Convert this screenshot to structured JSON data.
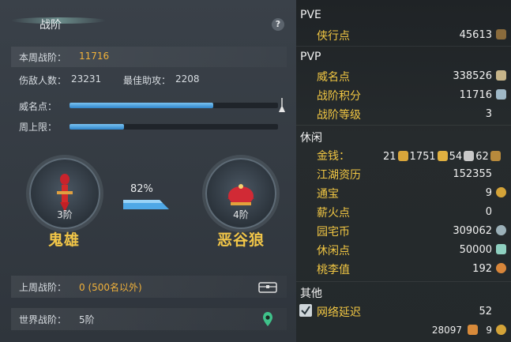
{
  "left": {
    "title": "战阶",
    "help_icon": "?",
    "weekly_label": "本周战阶：",
    "weekly_value": "11716",
    "kills_label": "伤敌人数：",
    "kills_value": "23231",
    "assist_label": "最佳助攻：",
    "assist_value": "2208",
    "prestige_label": "威名点：",
    "prestige_progress": 0.69,
    "weekly_cap_label": "周上限：",
    "weekly_cap_progress": 0.26,
    "current_tier": {
      "level": "3阶",
      "name": "鬼雄"
    },
    "next_tier": {
      "level": "4阶",
      "name": "恶谷狼"
    },
    "tier_progress": "82%",
    "last_week_label": "上周战阶：",
    "last_week_value": "0 (500名以外)",
    "world_label": "世界战阶：",
    "world_value": "5阶"
  },
  "right": {
    "pve": {
      "heading": "PVE",
      "items": [
        {
          "label": "侠行点",
          "value": "45613"
        }
      ]
    },
    "pvp": {
      "heading": "PVP",
      "items": [
        {
          "label": "威名点",
          "value": "338526"
        },
        {
          "label": "战阶积分",
          "value": "11716"
        },
        {
          "label": "战阶等级",
          "value": "3"
        }
      ]
    },
    "leisure": {
      "heading": "休闲",
      "money_label": "金钱：",
      "money": [
        "21",
        "1751",
        "54",
        "62"
      ],
      "items": [
        {
          "label": "江湖资历",
          "value": "152355"
        },
        {
          "label": "通宝",
          "value": "9"
        },
        {
          "label": "薪火点",
          "value": "0"
        },
        {
          "label": "园宅币",
          "value": "309062"
        },
        {
          "label": "休闲点",
          "value": "50000"
        },
        {
          "label": "桃李值",
          "value": "192"
        }
      ]
    },
    "other": {
      "heading": "其他",
      "latency_label": "网络延迟",
      "latency_value": "52",
      "latency_checked": true
    },
    "footer": {
      "value1": "28097",
      "value2": "9"
    }
  },
  "colors": {
    "accent": "#f2c743",
    "orange": "#f0b13a",
    "bar": "#3a8fd6"
  }
}
